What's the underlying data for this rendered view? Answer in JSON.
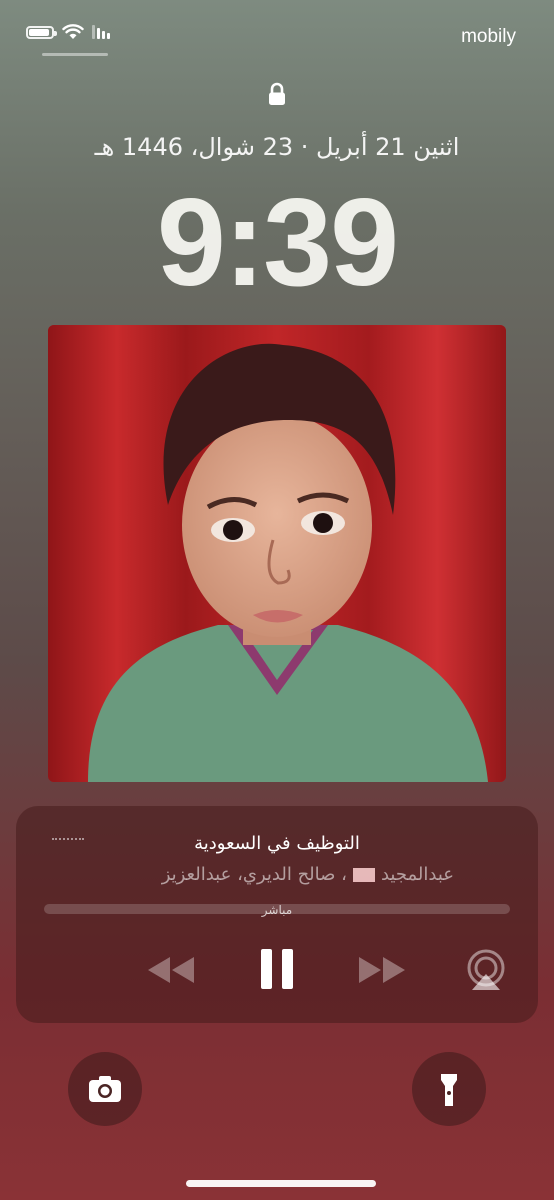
{
  "status_bar": {
    "carrier": "mobily",
    "battery_level": 0.9,
    "signal_bars": 4,
    "signal_bars_active": 3
  },
  "lock_screen": {
    "date": "اثنين 21 أبريل · 23 شوال، 1446 هـ",
    "time": "9:39"
  },
  "now_playing": {
    "title": "التوظيف في السعودية",
    "artist_before_flag": "عبدالمجيد",
    "artist_after_flag": "، صالح الديري، عبدالعزيز",
    "live_label": "مباشر",
    "colors": {
      "accent": "#ffffff",
      "dim": "rgba(255,255,255,0.55)"
    }
  },
  "icons": {
    "lock": "lock-icon",
    "rewind": "rewind-icon",
    "pause": "pause-icon",
    "forward": "fast-forward-icon",
    "airplay": "airplay-icon",
    "camera": "camera-icon",
    "flashlight": "flashlight-icon"
  }
}
